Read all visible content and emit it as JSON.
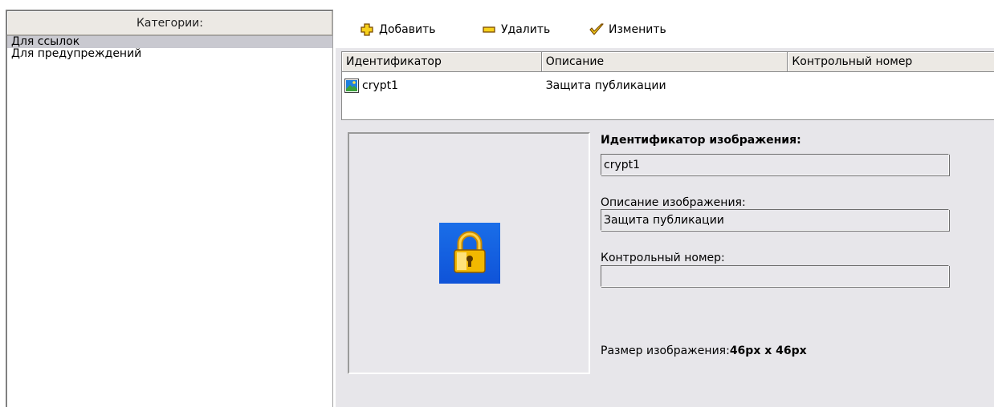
{
  "categories": {
    "header": "Категории:",
    "items": [
      {
        "label": "Для ссылок",
        "selected": true
      },
      {
        "label": "Для предупреждений",
        "selected": false
      }
    ]
  },
  "toolbar": {
    "add_label": "Добавить",
    "delete_label": "Удалить",
    "edit_label": "Изменить"
  },
  "table": {
    "columns": [
      "Идентификатор",
      "Описание",
      "Контрольный номер"
    ],
    "rows": [
      {
        "id": "crypt1",
        "description": "Защита публикации",
        "control_number": ""
      }
    ]
  },
  "details": {
    "id_label": "Идентификатор изображения:",
    "id_value": "crypt1",
    "description_label": "Описание изображения:",
    "description_value": "Защита публикации",
    "control_label": "Контрольный номер:",
    "control_value": "",
    "size_label": "Размер изображения:",
    "size_value": "46px x 46px"
  },
  "preview": {
    "icon": "padlock-icon"
  },
  "colors": {
    "selected_row": "#c9c9d0",
    "panel_bg": "#e7e6ea",
    "preview_bg": "#1a6ee8",
    "lock_gold": "#f2b800"
  }
}
